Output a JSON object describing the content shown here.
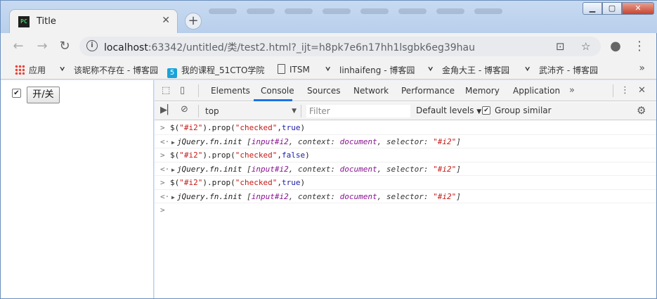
{
  "browser": {
    "tab_title": "Title",
    "favicon_text": "PC",
    "url_host": "localhost",
    "url_rest": ":63342/untitled/类/test2.html?_ijt=h8pk7e6n17hh1lsgbk6eg39hau",
    "bookmarks": [
      {
        "label": "应用",
        "icon": "apps-grid-icon"
      },
      {
        "label": "该昵称不存在 - 博客园",
        "icon": "cnblogs-icon"
      },
      {
        "label": "我的课程_51CTO学院",
        "icon": "51cto-icon"
      },
      {
        "label": "ITSM",
        "icon": "document-icon"
      },
      {
        "label": "linhaifeng - 博客园",
        "icon": "cnblogs-icon"
      },
      {
        "label": "金角大王 - 博客园",
        "icon": "cnblogs-icon"
      },
      {
        "label": "武沛齐 - 博客园",
        "icon": "cnblogs-icon"
      }
    ]
  },
  "page": {
    "checkbox_checked": true,
    "button_label": "开/关"
  },
  "devtools": {
    "tabs": [
      "Elements",
      "Console",
      "Sources",
      "Network",
      "Performance",
      "Memory",
      "Application"
    ],
    "active_tab": "Console",
    "context": "top",
    "filter_placeholder": "Filter",
    "levels_label": "Default levels",
    "group_similar_label": "Group similar",
    "console_lines": [
      {
        "type": "input",
        "selector": "\"#i2\"",
        "prop": "\"checked\"",
        "value": "true"
      },
      {
        "type": "output",
        "label": "jQuery.fn.init",
        "input": "input#i2",
        "context": "document",
        "selector": "\"#i2\""
      },
      {
        "type": "input",
        "selector": "\"#i2\"",
        "prop": "\"checked\"",
        "value": "false"
      },
      {
        "type": "output",
        "label": "jQuery.fn.init",
        "input": "input#i2",
        "context": "document",
        "selector": "\"#i2\""
      },
      {
        "type": "input",
        "selector": "\"#i2\"",
        "prop": "\"checked\"",
        "value": "true"
      },
      {
        "type": "output",
        "label": "jQuery.fn.init",
        "input": "input#i2",
        "context": "document",
        "selector": "\"#i2\""
      }
    ]
  }
}
